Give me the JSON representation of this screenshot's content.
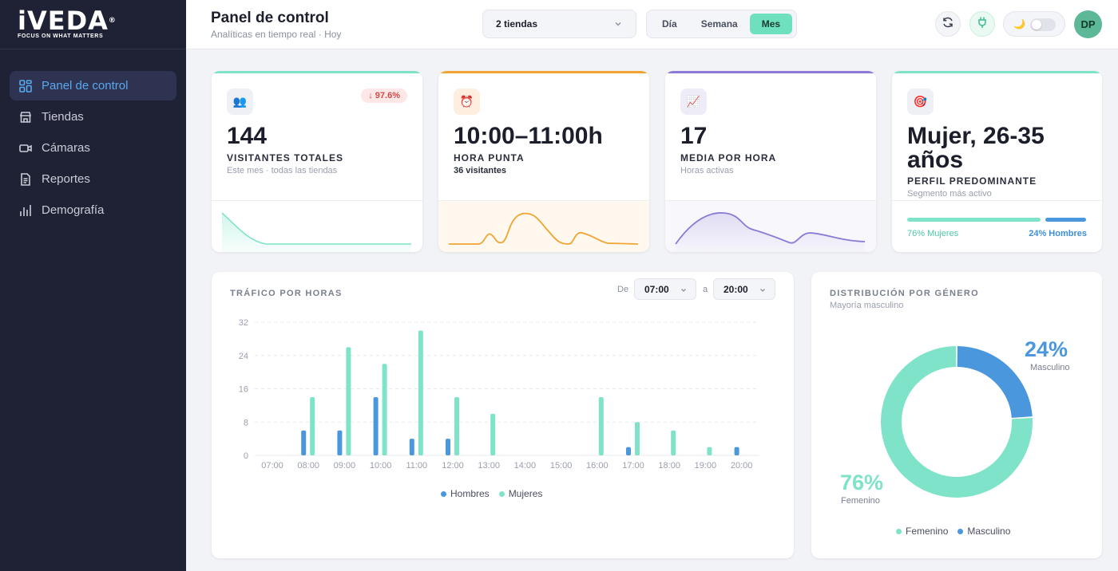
{
  "brand": {
    "name": "iVEDA",
    "tagline": "FOCUS ON WHAT MATTERS"
  },
  "sidebar": {
    "items": [
      {
        "label": "Panel de control",
        "icon": "grid-icon",
        "active": true
      },
      {
        "label": "Tiendas",
        "icon": "store-icon",
        "active": false
      },
      {
        "label": "Cámaras",
        "icon": "camera-icon",
        "active": false
      },
      {
        "label": "Reportes",
        "icon": "document-icon",
        "active": false
      },
      {
        "label": "Demografía",
        "icon": "bar-chart-icon",
        "active": false
      }
    ]
  },
  "header": {
    "title": "Panel de control",
    "subtitle": "Analíticas en tiempo real · Hoy",
    "store_select": "2 tiendas",
    "periods": [
      {
        "label": "Día",
        "active": false
      },
      {
        "label": "Semana",
        "active": false
      },
      {
        "label": "Mes",
        "active": true
      }
    ],
    "avatar": "DP",
    "theme_icon": "🌙"
  },
  "kpis": {
    "visitors": {
      "icon": "👥",
      "value": "144",
      "label": "VISITANTES TOTALES",
      "sub": "Este mes · todas las tiendas",
      "badge": "↓ 97.6%",
      "color": "#6ee0be"
    },
    "peak": {
      "icon": "⏰",
      "value": "10:00–11:00h",
      "label": "HORA PUNTA",
      "sub": "36 visitantes",
      "color": "#f0a431"
    },
    "avg": {
      "icon": "📈",
      "value": "17",
      "label": "MEDIA POR HORA",
      "sub": "Horas activas",
      "color": "#8c7ad6"
    },
    "profile": {
      "icon": "🎯",
      "value_line1": "Mujer, 26-35",
      "value_line2": "años",
      "label": "PERFIL PREDOMINANTE",
      "sub": "Segmento más activo",
      "female_label": "76% Mujeres",
      "male_label": "24% Hombres",
      "female_fraction": 0.76,
      "color": "#6ee0be"
    }
  },
  "traffic": {
    "title": "TRÁFICO POR HORAS",
    "from_label": "De",
    "to_label": "a",
    "from_value": "07:00",
    "to_value": "20:00"
  },
  "gender": {
    "title": "DISTRIBUCIÓN POR GÉNERO",
    "subtitle": "Mayoría masculino",
    "male_pct": "24%",
    "male_label": "Masculino",
    "female_pct": "76%",
    "female_label": "Femenino"
  },
  "chart_data": [
    {
      "type": "bar",
      "categories": [
        "07:00",
        "08:00",
        "09:00",
        "10:00",
        "11:00",
        "12:00",
        "13:00",
        "14:00",
        "15:00",
        "16:00",
        "17:00",
        "18:00",
        "19:00",
        "20:00"
      ],
      "series": [
        {
          "name": "Hombres",
          "color": "#4a97de",
          "values": [
            0,
            6,
            6,
            14,
            4,
            4,
            0,
            0,
            0,
            0,
            2,
            0,
            0,
            2
          ]
        },
        {
          "name": "Mujeres",
          "color": "#7ee3c8",
          "values": [
            0,
            14,
            26,
            22,
            30,
            14,
            10,
            0,
            0,
            14,
            8,
            6,
            2,
            0
          ]
        }
      ],
      "yticks": [
        0,
        8,
        16,
        24,
        32
      ],
      "ylim": [
        0,
        32
      ],
      "legend": "bottom-center",
      "grid": true
    },
    {
      "type": "pie",
      "categories": [
        "Femenino",
        "Masculino"
      ],
      "values": [
        76,
        24
      ],
      "colors": [
        "#7ee3c8",
        "#4a97de"
      ],
      "legend": "bottom-center"
    }
  ]
}
